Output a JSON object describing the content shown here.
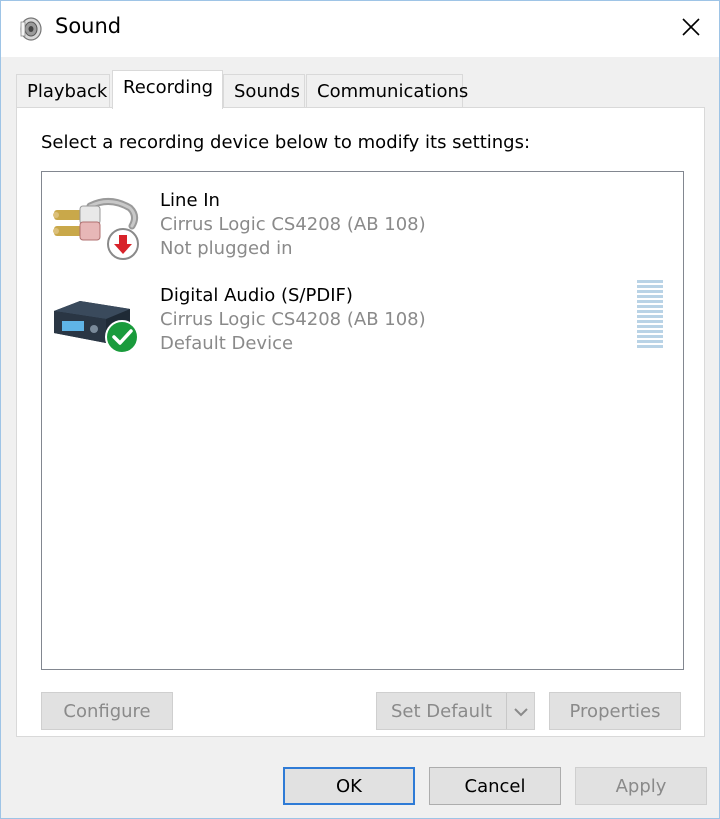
{
  "window": {
    "title": "Sound",
    "title_icon": "speaker-icon",
    "close_icon": "close-icon",
    "colors": {
      "accent": "#2f7bd6",
      "border": "#9ec4e6",
      "disabled_text": "#8a8a8a"
    }
  },
  "tabs": [
    {
      "label": "Playback",
      "active": false
    },
    {
      "label": "Recording",
      "active": true
    },
    {
      "label": "Sounds",
      "active": false
    },
    {
      "label": "Communications",
      "active": false
    }
  ],
  "recording": {
    "instruction": "Select a recording device below to modify its settings:",
    "devices": [
      {
        "name": "Line In",
        "driver": "Cirrus Logic CS4208 (AB 108)",
        "status": "Not plugged in",
        "icon": "rca-cable-icon",
        "badge": "unplugged-badge-icon"
      },
      {
        "name": "Digital Audio (S/PDIF)",
        "driver": "Cirrus Logic CS4208 (AB 108)",
        "status": "Default Device",
        "icon": "digital-audio-device-icon",
        "badge": "default-check-badge-icon",
        "level": 0
      }
    ],
    "buttons": {
      "configure": "Configure",
      "set_default": "Set Default",
      "properties": "Properties"
    }
  },
  "footer": {
    "ok": "OK",
    "cancel": "Cancel",
    "apply": "Apply"
  }
}
